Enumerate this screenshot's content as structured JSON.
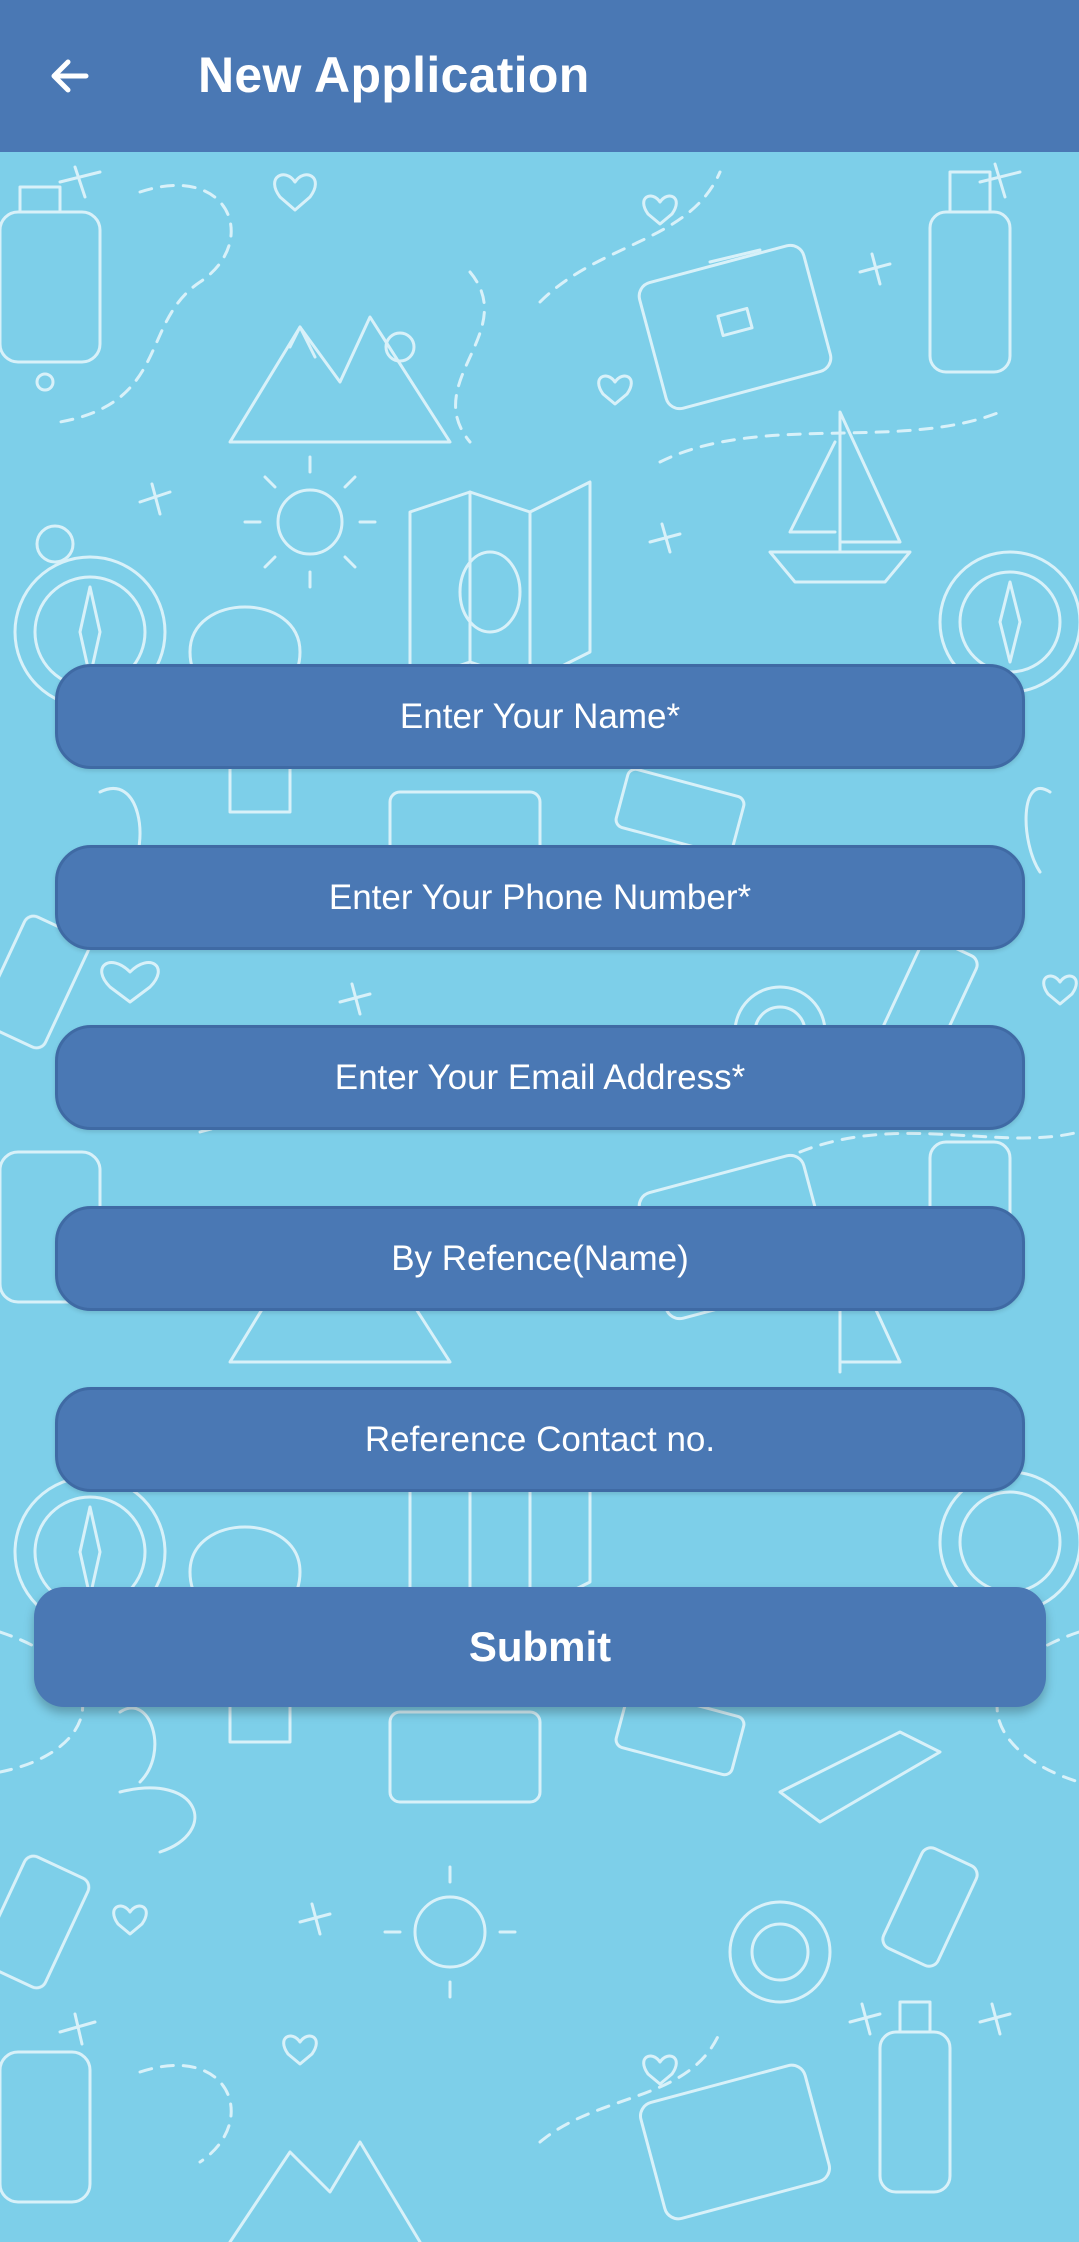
{
  "appbar": {
    "title": "New Application",
    "back_icon": "arrow-left-icon"
  },
  "form": {
    "name_placeholder": "Enter Your Name*",
    "phone_placeholder": "Enter Your Phone Number*",
    "email_placeholder": "Enter Your Email Address*",
    "reference_name_placeholder": "By Refence(Name)",
    "reference_contact_placeholder": "Reference Contact no.",
    "submit_label": "Submit"
  },
  "colors": {
    "appbar": "#4a78b4",
    "background": "#7dcfe9",
    "field": "#4a78b4",
    "text": "#ffffff"
  }
}
